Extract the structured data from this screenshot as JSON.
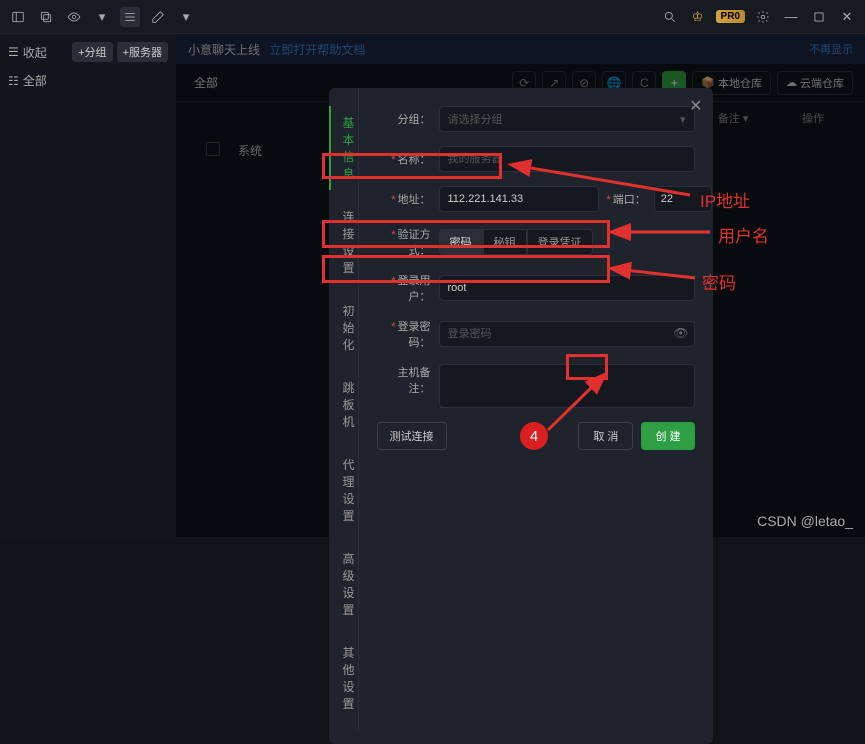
{
  "titlebar": {
    "pro": "PR0"
  },
  "sidebar": {
    "collapse": "收起",
    "add_group": "+分组",
    "add_server": "+服务器",
    "all": "全部"
  },
  "banner": {
    "text": "小意聊天上线",
    "link": "立即打开帮助文档",
    "dismiss": "不再显示"
  },
  "filter": {
    "all": "全部",
    "local_repo": "本地仓库",
    "cloud_repo": "云端仓库"
  },
  "table": {
    "head_name": "",
    "head_note": "备注",
    "head_action": "操作",
    "row1": "系统"
  },
  "modal": {
    "tabs": {
      "basic": "基本信息",
      "conn": "连接设置",
      "init": "初始化",
      "jump": "跳板机",
      "proxy": "代理设置",
      "adv": "高级设置",
      "other": "其他设置"
    },
    "fields": {
      "group": "分组：",
      "group_ph": "请选择分组",
      "name": "名称：",
      "name_ph": "我的服务器",
      "addr": "地址：",
      "addr_val": "112.221.141.33",
      "port": "端口：",
      "port_val": "22",
      "auth": "验证方式：",
      "auth_pw": "密码",
      "auth_key": "秘钥",
      "auth_cred": "登录凭证",
      "user": "登录用户：",
      "user_val": "root",
      "pass": "登录密码：",
      "pass_ph": "登录密码",
      "note": "主机备注："
    },
    "footer": {
      "test": "测试连接",
      "cancel": "取 消",
      "create": "创 建"
    }
  },
  "anno": {
    "ip": "IP地址",
    "user": "用户名",
    "pass": "密码",
    "step": "4"
  },
  "watermark": "CSDN @letao_"
}
